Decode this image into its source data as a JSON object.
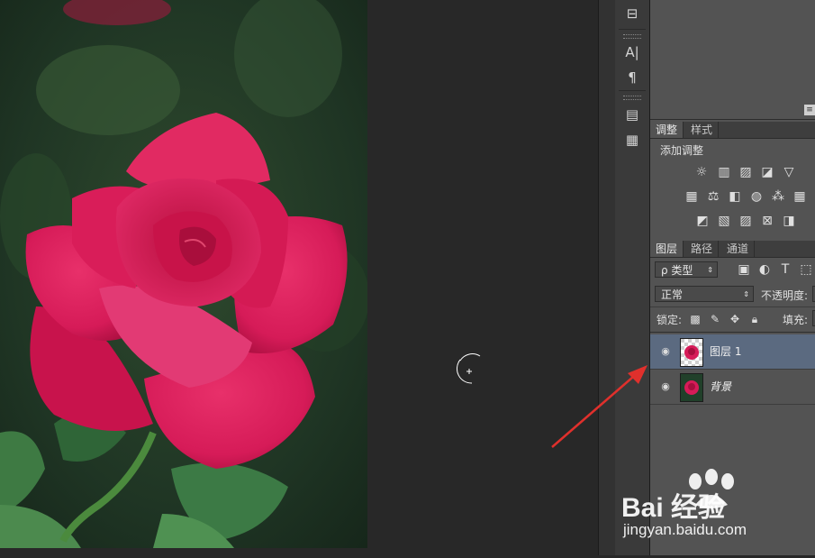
{
  "adjust_panel": {
    "tab_adjust": "调整",
    "tab_style": "样式",
    "add_adjustment": "添加调整"
  },
  "layers_panel": {
    "tab_layers": "图层",
    "tab_paths": "路径",
    "tab_channels": "通道",
    "filter_kind": "ρ 类型",
    "blend_mode": "正常",
    "opacity_label": "不透明度:",
    "lock_label": "锁定:",
    "fill_label": "填充:",
    "layers": [
      {
        "name": "图层 1"
      },
      {
        "name": "背景"
      }
    ]
  },
  "watermark": {
    "brand_text": "Bai 经验",
    "url": "jingyan.baidu.com"
  },
  "colors": {
    "accent_arrow": "#e0302c",
    "selected_layer": "#5b6a80",
    "panel_bg": "#535353"
  }
}
